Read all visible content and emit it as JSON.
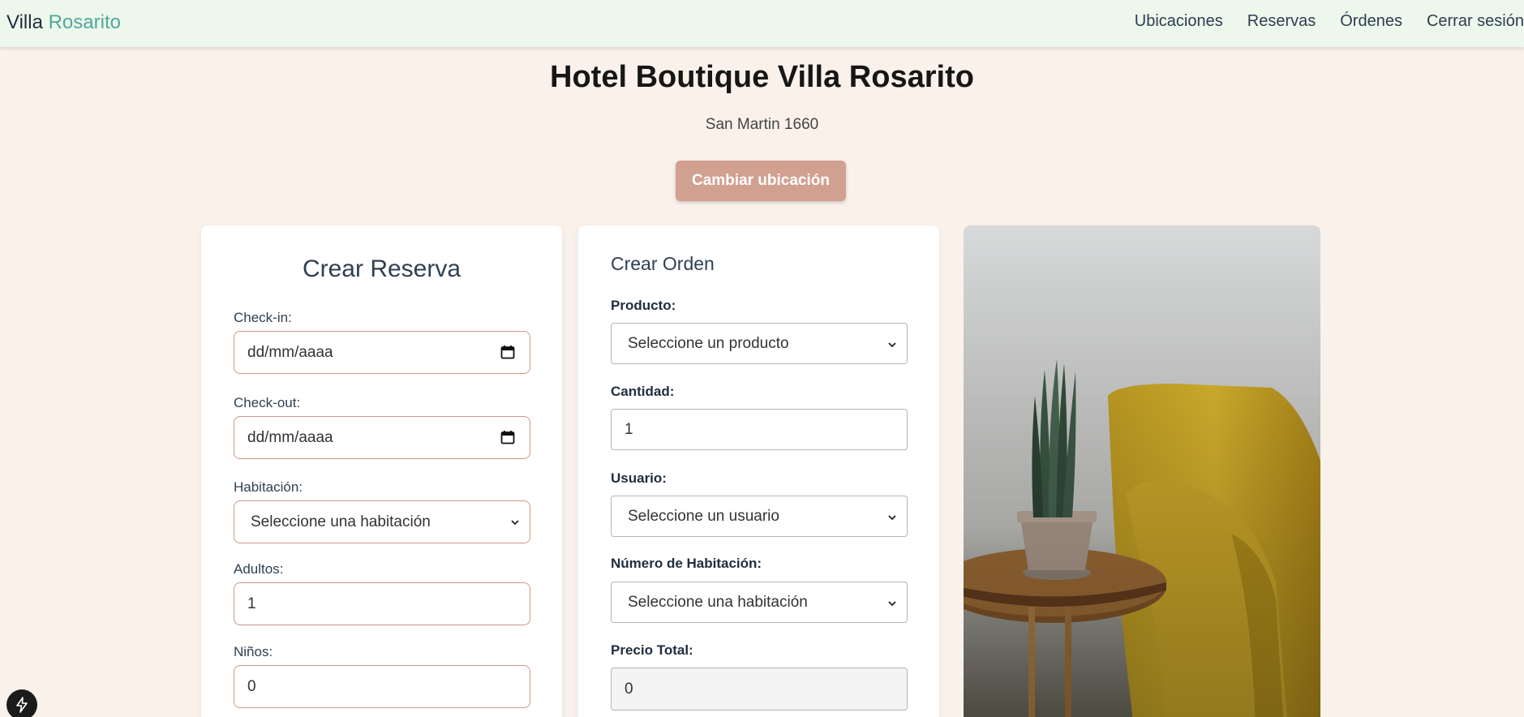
{
  "nav": {
    "brand_part1": "Villa",
    "brand_part2": "Rosarito",
    "links": [
      "Ubicaciones",
      "Reservas",
      "Órdenes",
      "Cerrar sesión"
    ]
  },
  "hotel": {
    "title": "Hotel Boutique Villa Rosarito",
    "address": "San Martin 1660",
    "change_button": "Cambiar ubicación"
  },
  "reservation": {
    "title": "Crear Reserva",
    "checkin_label": "Check-in:",
    "checkin_value": "dd/mm/aaaa",
    "checkout_label": "Check-out:",
    "checkout_value": "dd/mm/aaaa",
    "room_label": "Habitación:",
    "room_value": "Seleccione una habitación",
    "adults_label": "Adultos:",
    "adults_value": "1",
    "children_label": "Niños:",
    "children_value": "0"
  },
  "order": {
    "title": "Crear Orden",
    "product_label": "Producto:",
    "product_value": "Seleccione un producto",
    "quantity_label": "Cantidad:",
    "quantity_value": "1",
    "user_label": "Usuario:",
    "user_value": "Seleccione un usuario",
    "room_label": "Número de Habitación:",
    "room_value": "Seleccione una habitación",
    "total_label": "Precio Total:",
    "total_value": "0"
  },
  "colors": {
    "page_bg": "#f9f1ea",
    "navbar_bg": "#eef7ec",
    "accent": "#d2a090",
    "brand_teal": "#4fa89c"
  }
}
